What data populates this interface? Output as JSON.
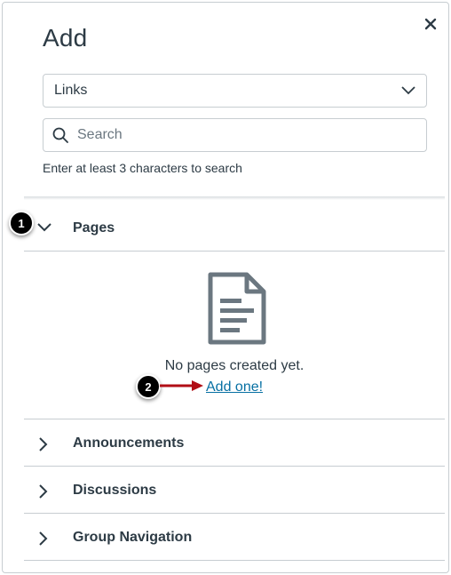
{
  "panel": {
    "title": "Add",
    "close_icon": "close-icon",
    "close_glyph": "✕"
  },
  "link_type_select": {
    "selected": "Links",
    "icon": "chevron-down-icon"
  },
  "search": {
    "placeholder": "Search",
    "value": "",
    "icon": "search-icon",
    "hint": "Enter at least 3 characters to search"
  },
  "sections": [
    {
      "label": "Pages",
      "expanded": true,
      "icon": "chevron-down-icon"
    },
    {
      "label": "Announcements",
      "expanded": false,
      "icon": "chevron-right-icon"
    },
    {
      "label": "Discussions",
      "expanded": false,
      "icon": "chevron-right-icon"
    },
    {
      "label": "Group Navigation",
      "expanded": false,
      "icon": "chevron-right-icon"
    }
  ],
  "pages_empty": {
    "icon": "document-icon",
    "message": "No pages created yet.",
    "link_text": "Add one!"
  },
  "callouts": [
    {
      "number": "1"
    },
    {
      "number": "2"
    }
  ],
  "colors": {
    "text": "#2d3b45",
    "link": "#0770a3",
    "border": "#c7cdd1",
    "callout_arrow": "#b10d15",
    "icon_gray": "#6b7780"
  }
}
